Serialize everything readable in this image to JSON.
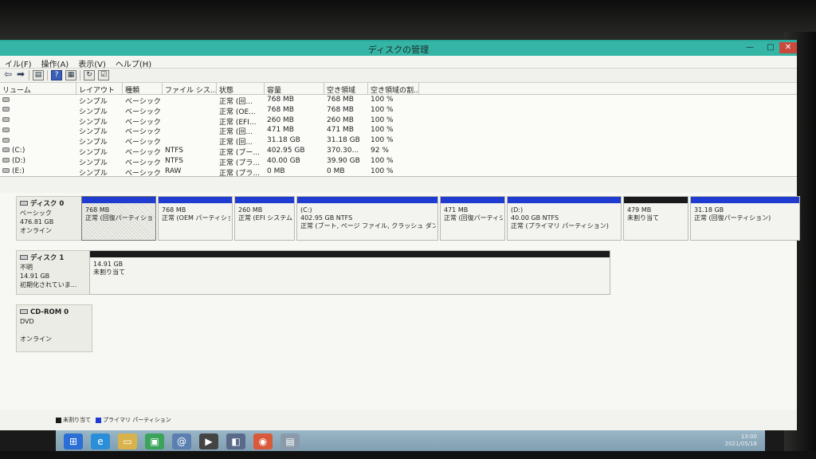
{
  "window": {
    "title": "ディスクの管理",
    "controls": {
      "minimize": "—",
      "maximize": "□",
      "close": "✕"
    }
  },
  "menu": [
    "イル(F)",
    "操作(A)",
    "表示(V)",
    "ヘルプ(H)"
  ],
  "toolbar": {
    "icons": [
      "back-arrow-icon",
      "forward-arrow-icon",
      "console-icon",
      "help-icon",
      "panel-icon",
      "refresh-icon",
      "properties-icon"
    ],
    "help_glyph": "?"
  },
  "volume_table": {
    "headers": [
      "リューム",
      "レイアウト",
      "種類",
      "ファイル シス...",
      "状態",
      "容量",
      "空き領域",
      "空き領域の割..."
    ],
    "rows": [
      [
        "",
        "シンプル",
        "ベーシック",
        "",
        "正常 (回...",
        "768 MB",
        "768 MB",
        "100 %"
      ],
      [
        "",
        "シンプル",
        "ベーシック",
        "",
        "正常 (OE...",
        "768 MB",
        "768 MB",
        "100 %"
      ],
      [
        "",
        "シンプル",
        "ベーシック",
        "",
        "正常 (EFI...",
        "260 MB",
        "260 MB",
        "100 %"
      ],
      [
        "",
        "シンプル",
        "ベーシック",
        "",
        "正常 (回...",
        "471 MB",
        "471 MB",
        "100 %"
      ],
      [
        "",
        "シンプル",
        "ベーシック",
        "",
        "正常 (回...",
        "31.18 GB",
        "31.18 GB",
        "100 %"
      ],
      [
        "(C:)",
        "シンプル",
        "ベーシック",
        "NTFS",
        "正常 (ブー...",
        "402.95 GB",
        "370.30...",
        "92 %"
      ],
      [
        "(D:)",
        "シンプル",
        "ベーシック",
        "NTFS",
        "正常 (プラ...",
        "40.00 GB",
        "39.90 GB",
        "100 %"
      ],
      [
        "(E:)",
        "シンプル",
        "ベーシック",
        "RAW",
        "正常 (プラ...",
        "0 MB",
        "0 MB",
        "100 %"
      ]
    ]
  },
  "disks": [
    {
      "name": "ディスク 0",
      "type": "ベーシック",
      "size": "476.81 GB",
      "status": "オンライン",
      "partitions": [
        {
          "label": "",
          "size": "768 MB",
          "status": "正常 (回復パーティション)",
          "bar": "primary"
        },
        {
          "label": "",
          "size": "768 MB",
          "status": "正常 (OEM パーティション)",
          "bar": "primary"
        },
        {
          "label": "",
          "size": "260 MB",
          "status": "正常 (EFI システム)",
          "bar": "primary"
        },
        {
          "label": "(C:)",
          "size": "402.95 GB NTFS",
          "status": "正常 (ブート, ページ ファイル, クラッシュ ダンプ, プ",
          "bar": "primary"
        },
        {
          "label": "",
          "size": "471 MB",
          "status": "正常 (回復パーティション)",
          "bar": "primary"
        },
        {
          "label": "(D:)",
          "size": "40.00 GB NTFS",
          "status": "正常 (プライマリ パーティション)",
          "bar": "primary"
        },
        {
          "label": "",
          "size": "479 MB",
          "status": "未割り当て",
          "bar": "unallocated"
        },
        {
          "label": "",
          "size": "31.18 GB",
          "status": "正常 (回復パーティション)",
          "bar": "primary"
        }
      ]
    },
    {
      "name": "ディスク 1",
      "type": "不明",
      "size": "14.91 GB",
      "status": "初期化されていま...",
      "partitions": [
        {
          "label": "",
          "size": "14.91 GB",
          "status": "未割り当て",
          "bar": "unallocated"
        }
      ]
    },
    {
      "name": "CD-ROM 0",
      "type": "DVD",
      "size": "",
      "status": "オンライン",
      "partitions": []
    }
  ],
  "legend": {
    "unallocated": "未割り当て",
    "primary": "プライマリ パーティション"
  },
  "colors": {
    "primary": "#1f3bd0",
    "unallocated": "#1a1a1a",
    "titlebar": "#34b5a6"
  },
  "tray": {
    "time": "13:00",
    "date": "2021/05/18"
  }
}
